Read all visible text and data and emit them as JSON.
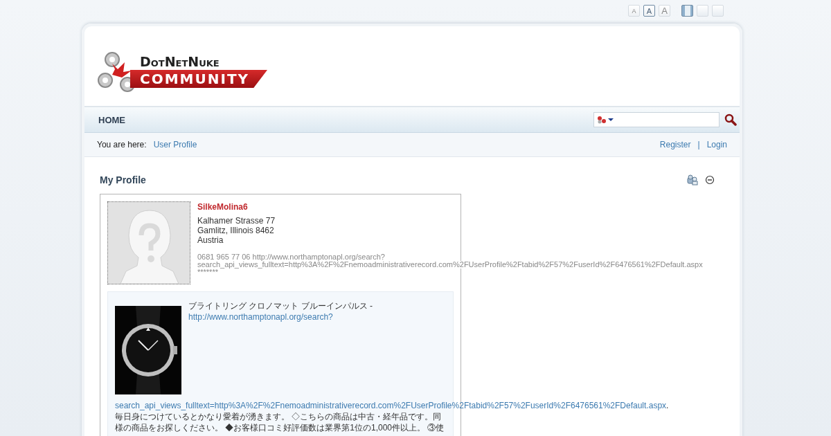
{
  "toolbar": {
    "font_sizes": [
      {
        "label": "A",
        "selected": false
      },
      {
        "label": "A",
        "selected": true
      },
      {
        "label": "A",
        "selected": false
      }
    ],
    "layouts": [
      {
        "selected": true
      },
      {
        "selected": false
      },
      {
        "selected": false
      }
    ]
  },
  "logo": {
    "top": "DotNetNuke",
    "bottom": "COMMUNITY"
  },
  "nav": {
    "items": [
      {
        "label": "HOME"
      }
    ]
  },
  "breadcrumb": {
    "prefix": "You are here:",
    "items": [
      "User Profile"
    ]
  },
  "account": {
    "links": [
      "Register",
      "Login"
    ],
    "separator": "|"
  },
  "module": {
    "title": "My Profile"
  },
  "profile": {
    "username": "SilkeMolina6",
    "address_lines": [
      "Kalhamer Strasse 77",
      "Gamlitz, Illinois 8462",
      "Austria"
    ],
    "details": [
      "0681 965 77 06 http://www.northamptonapl.org/search?",
      "search_api_views_fulltext=http%3A%2F%2Fnemoadministrativerecord.com%2FUserProfile%2Ftabid%2F57%2FuserId%2F6476561%2FDefault.aspx",
      "*******"
    ],
    "bio": {
      "heading": "ブライトリング クロノマット ブルーインパルス -",
      "link": "http://www.northamptonapl.org/search?",
      "link_2": "search_api_views_fulltext=http%3A%2F%2Fnemoadministrativerecord.com%2FUserProfile%2Ftabid%2F57%2FuserId%2F6476561%2FDefault.aspx",
      "link_2_tail": ".",
      "paragraph": "毎日身につけているとかなり愛着が湧きます。 ◇こちらの商品は中古・経年品です。同様の商品をお探しください。 ◆お客様口コミ好評価数は業界第1位の1,000件以上。 ③使"
    }
  }
}
